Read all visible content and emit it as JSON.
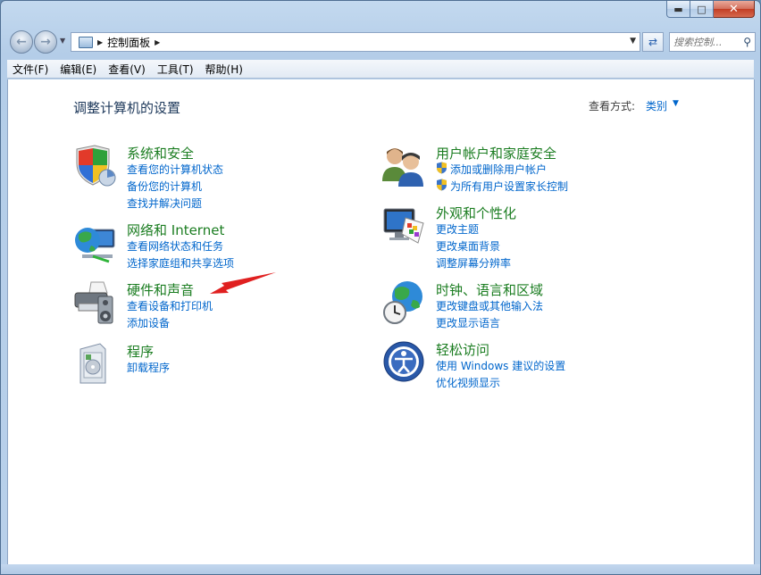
{
  "address": {
    "crumb": "控制面板",
    "search_placeholder": "搜索控制..."
  },
  "menu": [
    "文件(F)",
    "编辑(E)",
    "查看(V)",
    "工具(T)",
    "帮助(H)"
  ],
  "page": {
    "title": "调整计算机的设置",
    "view_by_label": "查看方式:",
    "view_by_value": "类别"
  },
  "categories_left": [
    {
      "title": "系统和安全",
      "links": [
        "查看您的计算机状态",
        "备份您的计算机",
        "查找并解决问题"
      ]
    },
    {
      "title": "网络和 Internet",
      "links": [
        "查看网络状态和任务",
        "选择家庭组和共享选项"
      ]
    },
    {
      "title": "硬件和声音",
      "links": [
        "查看设备和打印机",
        "添加设备"
      ]
    },
    {
      "title": "程序",
      "links": [
        "卸载程序"
      ]
    }
  ],
  "categories_right": [
    {
      "title": "用户帐户和家庭安全",
      "links": [
        "添加或删除用户帐户",
        "为所有用户设置家长控制"
      ]
    },
    {
      "title": "外观和个性化",
      "links": [
        "更改主题",
        "更改桌面背景",
        "调整屏幕分辨率"
      ]
    },
    {
      "title": "时钟、语言和区域",
      "links": [
        "更改键盘或其他输入法",
        "更改显示语言"
      ]
    },
    {
      "title": "轻松访问",
      "links": [
        "使用 Windows 建议的设置",
        "优化视频显示"
      ]
    }
  ],
  "colors": {
    "category_title": "#1b7d21",
    "link": "#0066cc",
    "annotation_arrow": "#e02020"
  },
  "icons": {
    "cat_system": "shield-icon",
    "cat_network": "network-globe-icon",
    "cat_hardware": "printer-speaker-icon",
    "cat_programs": "programs-box-icon",
    "cat_users": "users-icon",
    "cat_appearance": "monitor-palette-icon",
    "cat_clock": "clock-globe-icon",
    "cat_ease": "ease-of-access-icon"
  }
}
